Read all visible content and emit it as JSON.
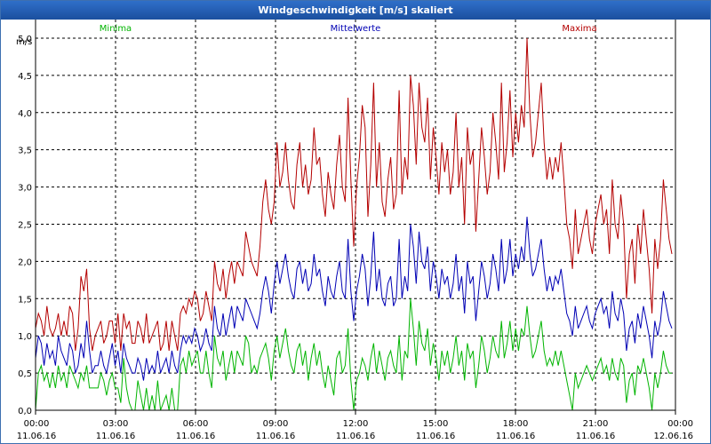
{
  "window": {
    "title": "Windgeschwindigkeit [m/s] skaliert"
  },
  "chart_data": {
    "type": "line",
    "title": "Windgeschwindigkeit [m/s] skaliert",
    "ylabel": "m/s",
    "ylim": [
      0,
      5.25
    ],
    "grid": true,
    "legend_position": "top",
    "y_ticks": [
      "0,0",
      "0,5",
      "1,0",
      "1,5",
      "2,0",
      "2,5",
      "3,0",
      "3,5",
      "4,0",
      "4,5",
      "5,0"
    ],
    "x_ticks": [
      {
        "time": "00:00",
        "date": "11.06.16"
      },
      {
        "time": "03:00",
        "date": "11.06.16"
      },
      {
        "time": "06:00",
        "date": "11.06.16"
      },
      {
        "time": "09:00",
        "date": "11.06.16"
      },
      {
        "time": "12:00",
        "date": "11.06.16"
      },
      {
        "time": "15:00",
        "date": "11.06.16"
      },
      {
        "time": "18:00",
        "date": "11.06.16"
      },
      {
        "time": "21:00",
        "date": "11.06.16"
      },
      {
        "time": "00:00",
        "date": "12.06.16"
      }
    ],
    "x_hours_per_sample": 0.1667,
    "series": [
      {
        "name": "Minima",
        "color": "#00b400",
        "values": [
          0.0,
          0.5,
          0.6,
          0.4,
          0.5,
          0.3,
          0.5,
          0.3,
          0.6,
          0.4,
          0.5,
          0.3,
          0.6,
          0.5,
          0.4,
          0.3,
          0.5,
          0.4,
          0.6,
          0.3,
          0.3,
          0.3,
          0.3,
          0.5,
          0.4,
          0.2,
          0.4,
          0.5,
          0.3,
          0.3,
          0.1,
          0.7,
          0.3,
          0.1,
          0.0,
          0.0,
          0.4,
          0.2,
          0.0,
          0.3,
          0.0,
          0.2,
          0.0,
          0.4,
          0.0,
          0.1,
          0.2,
          0.0,
          0.3,
          0.0,
          0.0,
          0.6,
          0.7,
          0.5,
          0.8,
          0.6,
          0.7,
          0.8,
          0.5,
          0.5,
          0.8,
          0.5,
          0.3,
          1.0,
          0.7,
          0.6,
          0.8,
          0.4,
          0.6,
          0.8,
          0.5,
          0.8,
          0.7,
          0.6,
          1.0,
          0.9,
          0.5,
          0.6,
          0.5,
          0.7,
          0.8,
          0.9,
          0.7,
          0.4,
          0.8,
          1.0,
          0.7,
          0.9,
          1.1,
          0.8,
          0.6,
          0.5,
          0.8,
          0.9,
          0.6,
          0.8,
          0.4,
          0.7,
          0.9,
          0.6,
          0.8,
          0.5,
          0.3,
          0.6,
          0.4,
          0.2,
          0.7,
          0.8,
          0.5,
          0.6,
          1.1,
          0.4,
          0.0,
          0.4,
          0.5,
          0.7,
          0.6,
          0.4,
          0.7,
          0.9,
          0.5,
          0.8,
          0.6,
          0.4,
          0.7,
          0.8,
          0.6,
          0.5,
          1.0,
          0.4,
          0.8,
          0.7,
          1.5,
          1.1,
          0.6,
          1.2,
          0.9,
          0.8,
          1.1,
          0.6,
          0.9,
          0.7,
          0.4,
          0.8,
          0.6,
          0.8,
          0.5,
          0.7,
          1.0,
          0.6,
          0.8,
          0.4,
          0.9,
          0.7,
          0.8,
          0.3,
          0.6,
          1.0,
          0.8,
          0.5,
          0.7,
          1.0,
          0.8,
          0.7,
          1.2,
          0.7,
          0.9,
          1.2,
          0.8,
          1.1,
          0.8,
          1.1,
          1.0,
          1.4,
          1.0,
          0.7,
          0.8,
          1.0,
          1.2,
          0.8,
          0.6,
          0.7,
          0.6,
          0.8,
          0.6,
          0.8,
          0.6,
          0.4,
          0.2,
          0.0,
          0.5,
          0.3,
          0.4,
          0.5,
          0.6,
          0.5,
          0.4,
          0.5,
          0.6,
          0.7,
          0.5,
          0.6,
          0.4,
          0.7,
          0.5,
          0.4,
          0.7,
          0.6,
          0.1,
          0.4,
          0.5,
          0.2,
          0.6,
          0.5,
          0.7,
          0.5,
          0.3,
          0.0,
          0.5,
          0.3,
          0.5,
          0.8,
          0.6,
          0.5,
          0.5
        ]
      },
      {
        "name": "Mittelwerte",
        "color": "#0000b4",
        "values": [
          0.7,
          1.0,
          0.9,
          0.6,
          0.9,
          0.7,
          0.8,
          0.6,
          1.0,
          0.8,
          0.7,
          0.6,
          0.9,
          0.8,
          0.5,
          0.6,
          0.9,
          0.7,
          1.2,
          0.8,
          0.5,
          0.6,
          0.6,
          0.8,
          0.6,
          0.5,
          0.7,
          0.9,
          0.6,
          0.8,
          0.5,
          0.9,
          0.7,
          0.6,
          0.5,
          0.5,
          0.7,
          0.6,
          0.4,
          0.7,
          0.5,
          0.6,
          0.5,
          0.8,
          0.5,
          0.6,
          0.7,
          0.5,
          0.8,
          0.6,
          0.5,
          0.8,
          1.0,
          0.9,
          1.0,
          0.9,
          1.1,
          1.0,
          0.8,
          0.9,
          1.1,
          0.9,
          0.8,
          1.4,
          1.1,
          1.0,
          1.3,
          1.0,
          1.2,
          1.4,
          1.1,
          1.4,
          1.3,
          1.2,
          1.5,
          1.4,
          1.3,
          1.2,
          1.1,
          1.3,
          1.6,
          1.8,
          1.6,
          1.3,
          1.7,
          2.0,
          1.7,
          1.9,
          2.1,
          1.8,
          1.6,
          1.5,
          1.9,
          2.0,
          1.7,
          1.9,
          1.6,
          1.7,
          2.1,
          1.8,
          1.9,
          1.6,
          1.4,
          1.8,
          1.6,
          1.5,
          1.8,
          2.0,
          1.6,
          1.5,
          2.3,
          1.6,
          1.2,
          1.6,
          1.8,
          2.1,
          1.9,
          1.4,
          1.8,
          2.4,
          1.6,
          1.9,
          1.5,
          1.4,
          1.7,
          1.8,
          1.4,
          1.5,
          2.3,
          1.5,
          1.8,
          1.6,
          2.5,
          2.2,
          1.7,
          2.4,
          2.0,
          1.9,
          2.2,
          1.6,
          2.0,
          1.8,
          1.5,
          1.9,
          1.7,
          1.8,
          1.5,
          1.7,
          2.1,
          1.6,
          1.8,
          1.3,
          2.0,
          1.7,
          1.8,
          1.2,
          1.6,
          2.0,
          1.8,
          1.5,
          1.7,
          2.1,
          1.9,
          1.6,
          2.3,
          1.7,
          1.9,
          2.3,
          1.8,
          2.1,
          1.9,
          2.2,
          2.0,
          2.6,
          2.1,
          1.8,
          1.9,
          2.1,
          2.3,
          1.9,
          1.6,
          1.8,
          1.6,
          1.8,
          1.7,
          1.9,
          1.6,
          1.3,
          1.2,
          1.0,
          1.4,
          1.1,
          1.2,
          1.3,
          1.4,
          1.2,
          1.1,
          1.3,
          1.4,
          1.5,
          1.3,
          1.4,
          1.1,
          1.6,
          1.3,
          1.2,
          1.5,
          1.3,
          0.8,
          1.1,
          1.2,
          0.9,
          1.3,
          1.1,
          1.4,
          1.2,
          1.0,
          0.7,
          1.2,
          1.0,
          1.2,
          1.6,
          1.4,
          1.2,
          1.1
        ]
      },
      {
        "name": "Maxima",
        "color": "#b40000",
        "values": [
          1.1,
          1.3,
          1.2,
          1.0,
          1.4,
          1.1,
          1.0,
          1.1,
          1.3,
          1.0,
          1.2,
          1.0,
          1.4,
          1.3,
          0.8,
          1.1,
          1.8,
          1.6,
          1.9,
          1.1,
          0.8,
          1.0,
          1.1,
          1.2,
          0.9,
          1.0,
          1.2,
          1.2,
          0.9,
          1.3,
          0.8,
          1.3,
          1.1,
          1.2,
          0.9,
          0.9,
          1.2,
          1.1,
          0.9,
          1.3,
          0.9,
          1.0,
          1.1,
          1.2,
          0.8,
          0.9,
          1.2,
          0.8,
          1.2,
          1.0,
          0.8,
          1.3,
          1.4,
          1.3,
          1.5,
          1.4,
          1.6,
          1.5,
          1.2,
          1.3,
          1.6,
          1.4,
          1.2,
          2.0,
          1.7,
          1.6,
          1.9,
          1.5,
          1.8,
          2.0,
          1.7,
          2.0,
          1.9,
          1.8,
          2.4,
          2.2,
          2.0,
          1.9,
          1.8,
          2.2,
          2.8,
          3.1,
          2.7,
          2.5,
          2.8,
          3.6,
          3.0,
          3.2,
          3.6,
          3.1,
          2.8,
          2.7,
          3.3,
          3.6,
          3.0,
          3.3,
          2.9,
          3.1,
          3.8,
          3.3,
          3.4,
          2.9,
          2.6,
          3.2,
          2.9,
          2.7,
          3.3,
          3.7,
          3.0,
          2.8,
          4.2,
          3.1,
          2.2,
          3.0,
          3.4,
          4.1,
          3.8,
          2.6,
          3.3,
          4.4,
          3.0,
          3.6,
          2.8,
          2.6,
          3.1,
          3.4,
          2.7,
          2.9,
          4.3,
          2.9,
          3.4,
          3.1,
          4.5,
          4.1,
          3.3,
          4.4,
          3.8,
          3.6,
          4.2,
          3.1,
          3.8,
          3.4,
          2.9,
          3.6,
          3.2,
          3.5,
          2.9,
          3.2,
          4.0,
          3.0,
          3.4,
          2.5,
          3.8,
          3.3,
          3.5,
          2.4,
          3.1,
          3.8,
          3.4,
          2.9,
          3.2,
          4.0,
          3.6,
          3.1,
          4.4,
          3.2,
          3.6,
          4.3,
          3.4,
          4.0,
          3.6,
          4.1,
          3.8,
          5.0,
          4.0,
          3.4,
          3.6,
          4.0,
          4.4,
          3.6,
          3.1,
          3.4,
          3.1,
          3.4,
          3.2,
          3.6,
          3.1,
          2.5,
          2.3,
          1.9,
          2.7,
          2.1,
          2.3,
          2.5,
          2.7,
          2.3,
          2.1,
          2.5,
          2.7,
          2.9,
          2.5,
          2.7,
          2.1,
          3.1,
          2.5,
          2.3,
          2.9,
          2.5,
          1.5,
          2.1,
          2.3,
          1.7,
          2.5,
          2.1,
          2.7,
          2.3,
          1.9,
          1.3,
          2.3,
          1.9,
          2.3,
          3.1,
          2.7,
          2.3,
          2.1
        ]
      }
    ]
  }
}
